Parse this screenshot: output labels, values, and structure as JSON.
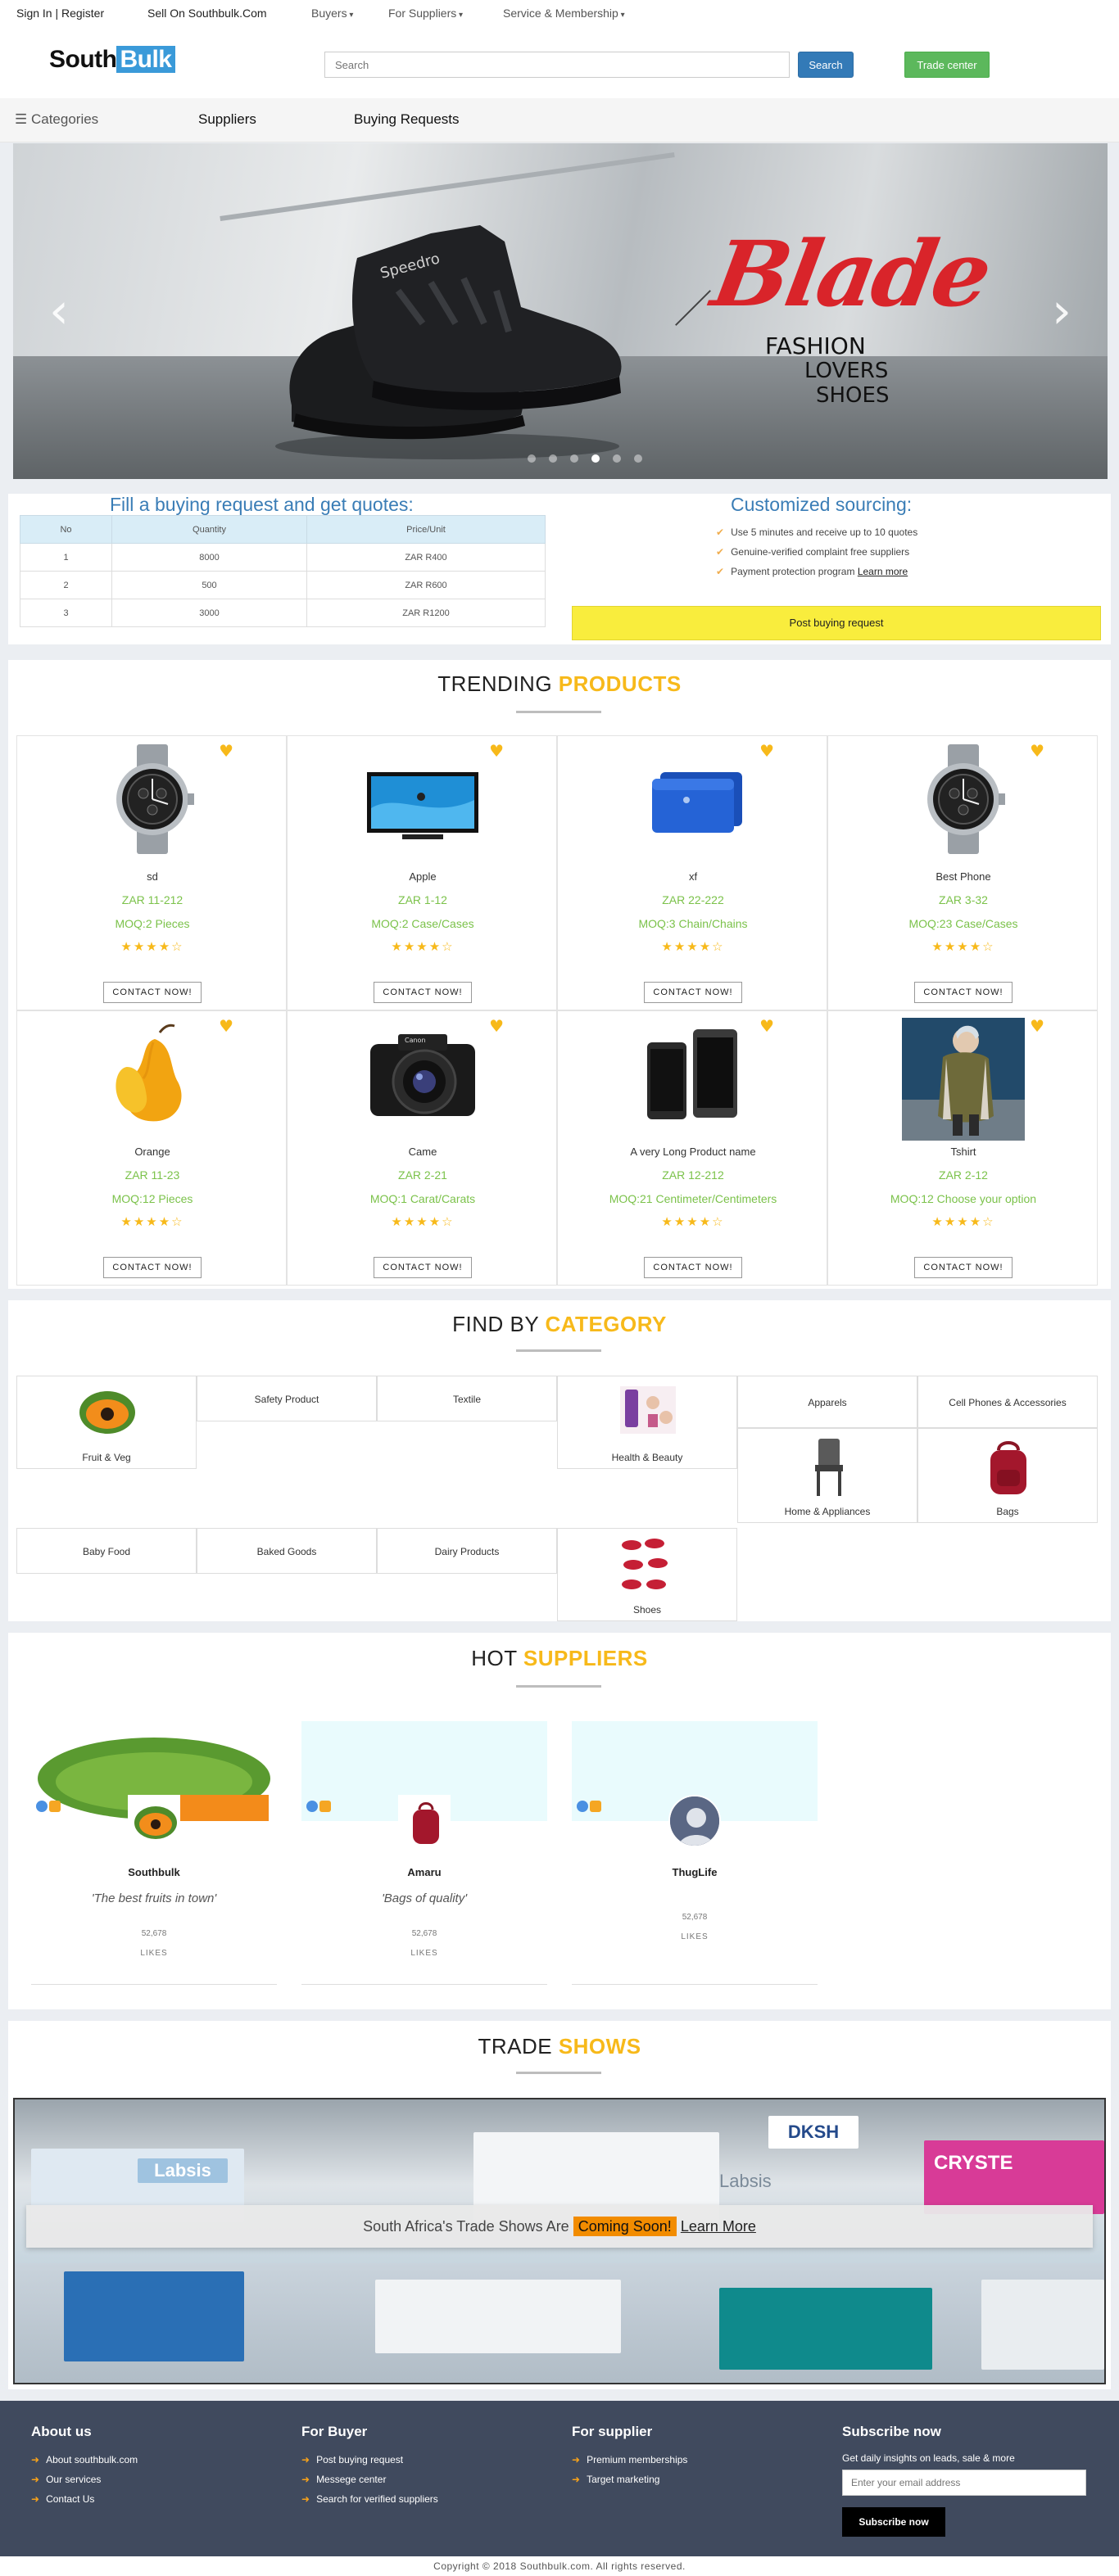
{
  "topbar": {
    "signin": "Sign In | Register",
    "sell": "Sell On Southbulk.Com",
    "buyers": "Buyers",
    "suppliers": "For Suppliers",
    "service": "Service & Membership"
  },
  "header": {
    "logo_part1": "South",
    "logo_part2": "Bulk",
    "search_placeholder": "Search",
    "search_button": "Search",
    "trade_center": "Trade center"
  },
  "nav": {
    "categories": "☰ Categories",
    "suppliers": "Suppliers",
    "buying_requests": "Buying Requests"
  },
  "hero": {
    "brand": "Blade",
    "line1": "FASHION",
    "line2": "LOVERS",
    "line3": "SHOES",
    "shoe_text": "Speedro"
  },
  "quote": {
    "title_left": "Fill a buying request and get quotes:",
    "columns": [
      "No",
      "Quantity",
      "Price/Unit"
    ],
    "rows": [
      [
        "1",
        "8000",
        "ZAR R400"
      ],
      [
        "2",
        "500",
        "ZAR R600"
      ],
      [
        "3",
        "3000",
        "ZAR R1200"
      ]
    ],
    "title_right": "Customized sourcing:",
    "benefits": [
      "Use 5 minutes and receive up to 10 quotes",
      "Genuine-verified complaint free suppliers",
      "Payment protection program"
    ],
    "learn_more": "Learn more",
    "post_button": "Post buying request"
  },
  "trending": {
    "title_a": "TRENDING",
    "title_b": "PRODUCTS",
    "contact_label": "CONTACT NOW!",
    "products": [
      {
        "name": "sd",
        "price": "ZAR 11-212",
        "moq": "MOQ:2 Pieces",
        "image": "watch"
      },
      {
        "name": "Apple",
        "price": "ZAR 1-12",
        "moq": "MOQ:2 Case/Cases",
        "image": "tv"
      },
      {
        "name": "xf",
        "price": "ZAR 22-222",
        "moq": "MOQ:3 Chain/Chains",
        "image": "hdd"
      },
      {
        "name": "Best Phone",
        "price": "ZAR 3-32",
        "moq": "MOQ:23 Case/Cases",
        "image": "watch"
      },
      {
        "name": "Orange",
        "price": "ZAR 11-23",
        "moq": "MOQ:12 Pieces",
        "image": "pear"
      },
      {
        "name": "Came",
        "price": "ZAR 2-21",
        "moq": "MOQ:1 Carat/Carats",
        "image": "camera"
      },
      {
        "name": "A very Long Product name",
        "price": "ZAR 12-212",
        "moq": "MOQ:21 Centimeter/Centimeters",
        "image": "phone"
      },
      {
        "name": "Tshirt",
        "price": "ZAR 2-12",
        "moq": "MOQ:12 Choose your option",
        "image": "person"
      }
    ]
  },
  "category": {
    "title_a": "FIND BY",
    "title_b": "CATEGORY",
    "items": [
      "Fruit & Veg",
      "Safety Product",
      "Textile",
      "Health & Beauty",
      "Apparels",
      "Cell Phones & Accessories",
      "Home & Appliances",
      "Bags",
      "Baby Food",
      "Baked Goods",
      "Dairy Products",
      "Shoes"
    ]
  },
  "suppliers": {
    "title_a": "HOT",
    "title_b": "SUPPLIERS",
    "likes_label": "LIKES",
    "list": [
      {
        "name": "Southbulk",
        "quote": "'The best fruits in town'",
        "likes": "52,678"
      },
      {
        "name": "Amaru",
        "quote": "'Bags of quality'",
        "likes": "52,678"
      },
      {
        "name": "ThugLife",
        "quote": "",
        "likes": "52,678"
      }
    ]
  },
  "trade": {
    "title_a": "TRADE",
    "title_b": "SHOWS",
    "banner_text": "South Africa's Trade Shows Are",
    "coming": "Coming Soon!",
    "learn": "Learn More",
    "signs": [
      "Labsis",
      "CRYSTE",
      "DKSH",
      "Labsis"
    ]
  },
  "footer": {
    "about_title": "About us",
    "about_links": [
      "About southbulk.com",
      "Our services",
      "Contact Us"
    ],
    "buyer_title": "For Buyer",
    "buyer_links": [
      "Post buying request",
      "Messege center",
      "Search for verified suppliers"
    ],
    "supplier_title": "For supplier",
    "supplier_links": [
      "Premium memberships",
      "Target marketing"
    ],
    "subscribe_title": "Subscribe now",
    "subscribe_text": "Get daily insights on leads, sale & more",
    "email_placeholder": "Enter your email address",
    "subscribe_button": "Subscribe now",
    "copyright": "Copyright © 2018 Southbulk.com. All rights reserved."
  },
  "colors": {
    "accent": "#f7b91a",
    "price_green": "#7bc24a",
    "primary_blue": "#337ab7",
    "footer_bg": "#404a5e"
  }
}
